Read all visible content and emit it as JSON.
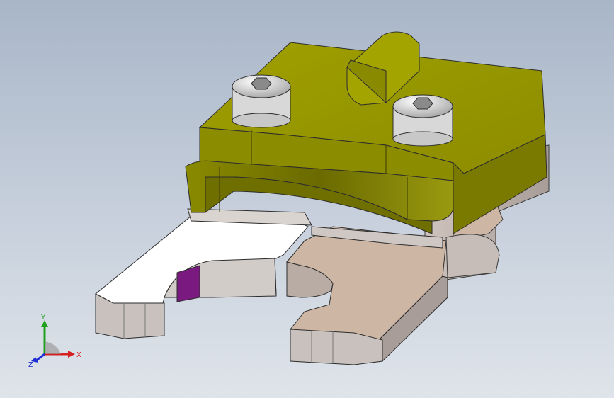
{
  "viewport": {
    "background_top": "#a9b6c8",
    "background_bottom": "#dfe4ea"
  },
  "colors": {
    "clamp_body": "#9a9a00",
    "clamp_body_dark": "#6f6f00",
    "base_plate": "#d9cfc8",
    "left_jaw_top": "#ffffff",
    "right_jaw_top": "#cdb6a4",
    "jaw_side": "#c9c1bd",
    "selected_face": "#7a1a80",
    "screw_head": "#e6e6e6"
  },
  "triad": {
    "x_label": "X",
    "y_label": "Y",
    "z_label": "Z",
    "x_color": "#d42020",
    "y_color": "#1fa11f",
    "z_color": "#1f2fd4"
  }
}
